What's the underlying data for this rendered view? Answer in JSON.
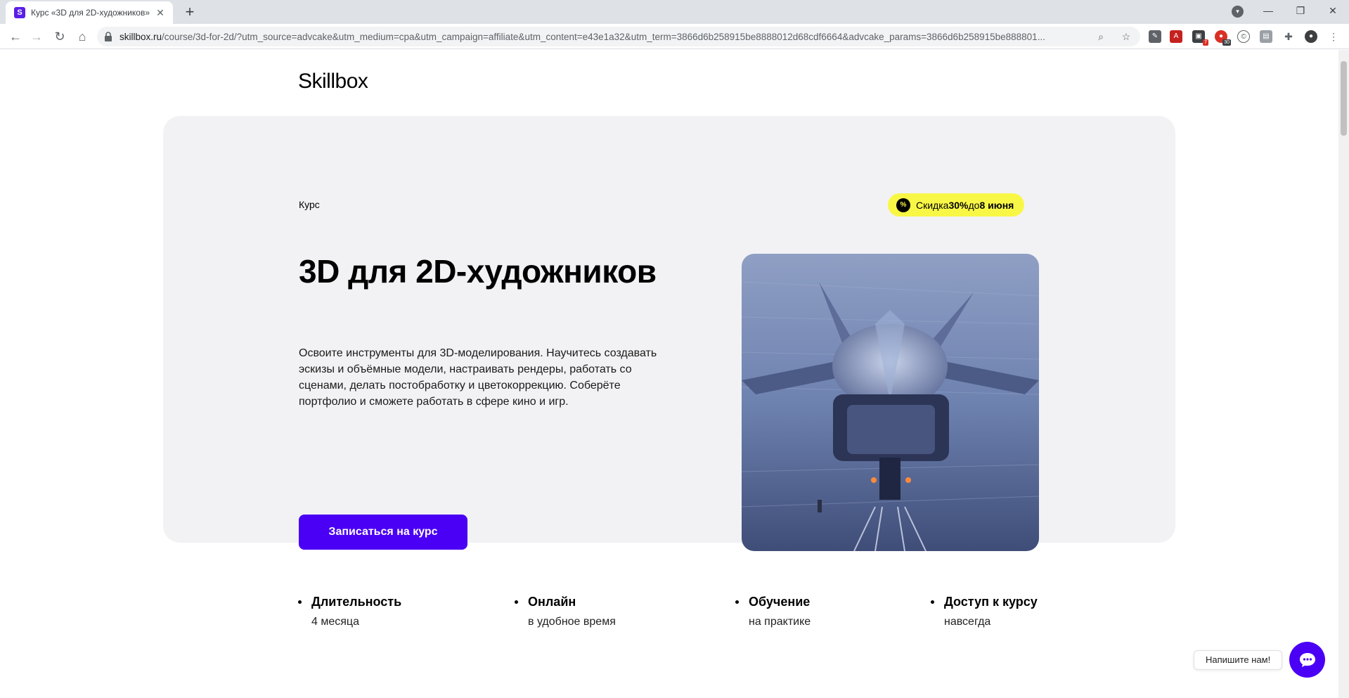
{
  "browser": {
    "tab_title": "Курс «3D для 2D-художников»",
    "favicon_letter": "S",
    "url_host": "skillbox.ru",
    "url_path": "/course/3d-for-2d/?utm_source=advcake&utm_medium=cpa&utm_campaign=affiliate&utm_content=e43e1a32&utm_term=3866d6b258915be8888012d68cdf6664&advcake_params=3866d6b258915be888801...",
    "ext_badge_1": "7",
    "ext_badge_2": "30"
  },
  "header": {
    "logo": "Skillbox"
  },
  "hero": {
    "label": "Курс",
    "promo_prefix": "Скидка ",
    "promo_percent": "30%",
    "promo_mid": " до ",
    "promo_date": "8 июня",
    "promo_icon": "%",
    "title": "3D для 2D-художников",
    "description": "Освоите инструменты для 3D-моделирования. Научитесь создавать эскизы и объёмные модели, настраивать рендеры, работать со сценами, делать постобработку и цветокоррекцию. Соберёте портфолио и сможете работать в сфере кино и игр.",
    "cta": "Записаться на курс"
  },
  "features": [
    {
      "title": "Длительность",
      "sub": "4 месяца"
    },
    {
      "title": "Онлайн",
      "sub": "в удобное время"
    },
    {
      "title": "Обучение",
      "sub": "на практике"
    },
    {
      "title": "Доступ к курсу",
      "sub": "навсегда"
    }
  ],
  "chat": {
    "label": "Напишите нам!"
  },
  "colors": {
    "accent": "#4a00f5",
    "promo": "#f9f746",
    "hero_bg": "#f2f2f4"
  }
}
